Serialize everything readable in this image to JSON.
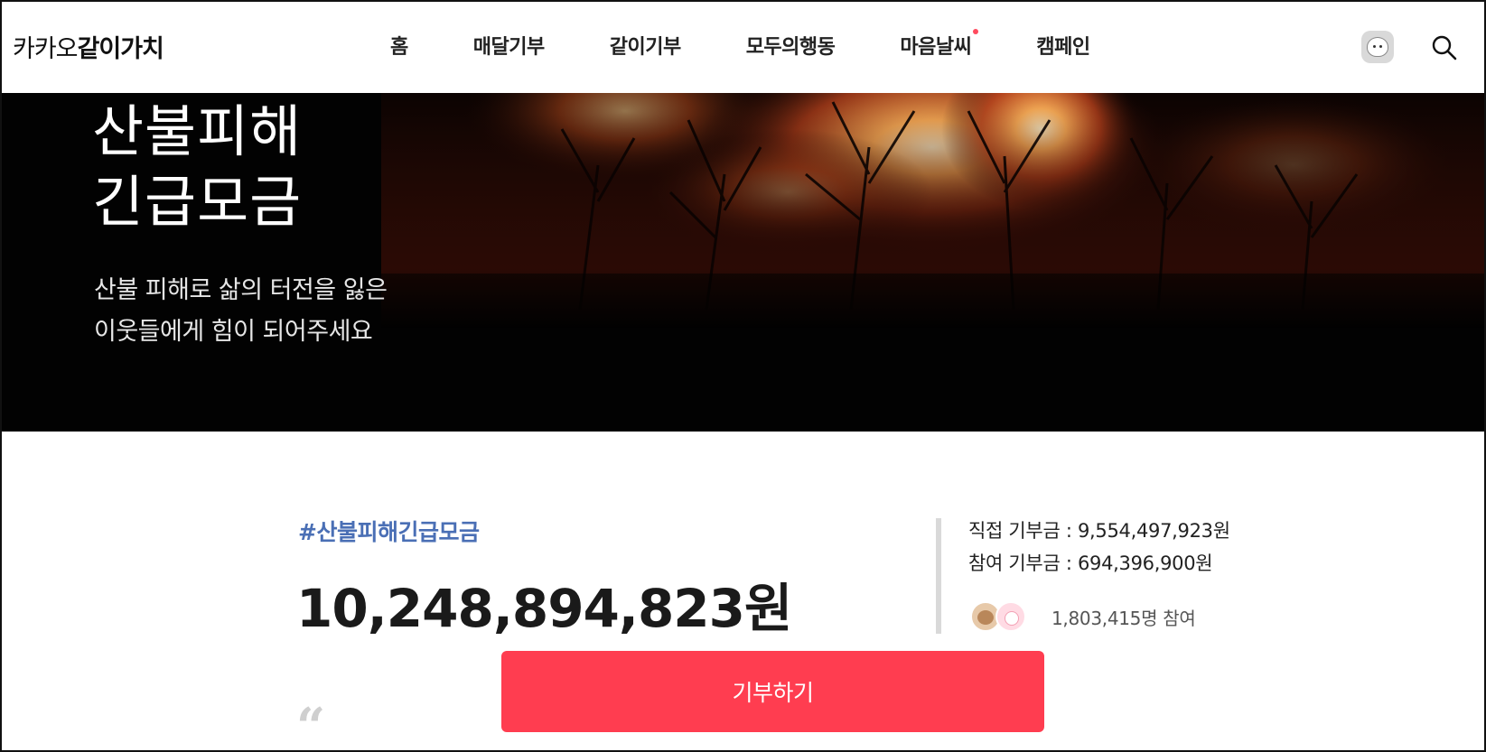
{
  "header": {
    "logo_prefix": "카카오",
    "logo_main": "같이가치",
    "nav": [
      "홈",
      "매달기부",
      "같이기부",
      "모두의행동",
      "마음날씨",
      "캠페인"
    ],
    "nav_dot_index": 4,
    "accent_color": "#ff3d50"
  },
  "hero": {
    "title_line1": "산불피해",
    "title_line2": "긴급모금",
    "sub_line1": "산불 피해로 삶의 터전을 잃은",
    "sub_line2": "이웃들에게 힘이 되어주세요"
  },
  "stats": {
    "hashtag": "#산불피해긴급모금",
    "total": "10,248,894,823원",
    "direct": "직접 기부금 : 9,554,497,923원",
    "participation": "참여 기부금 : 694,396,900원",
    "participants": "1,803,415명 참여"
  },
  "donate_label": "기부하기",
  "quote_mark": "“"
}
